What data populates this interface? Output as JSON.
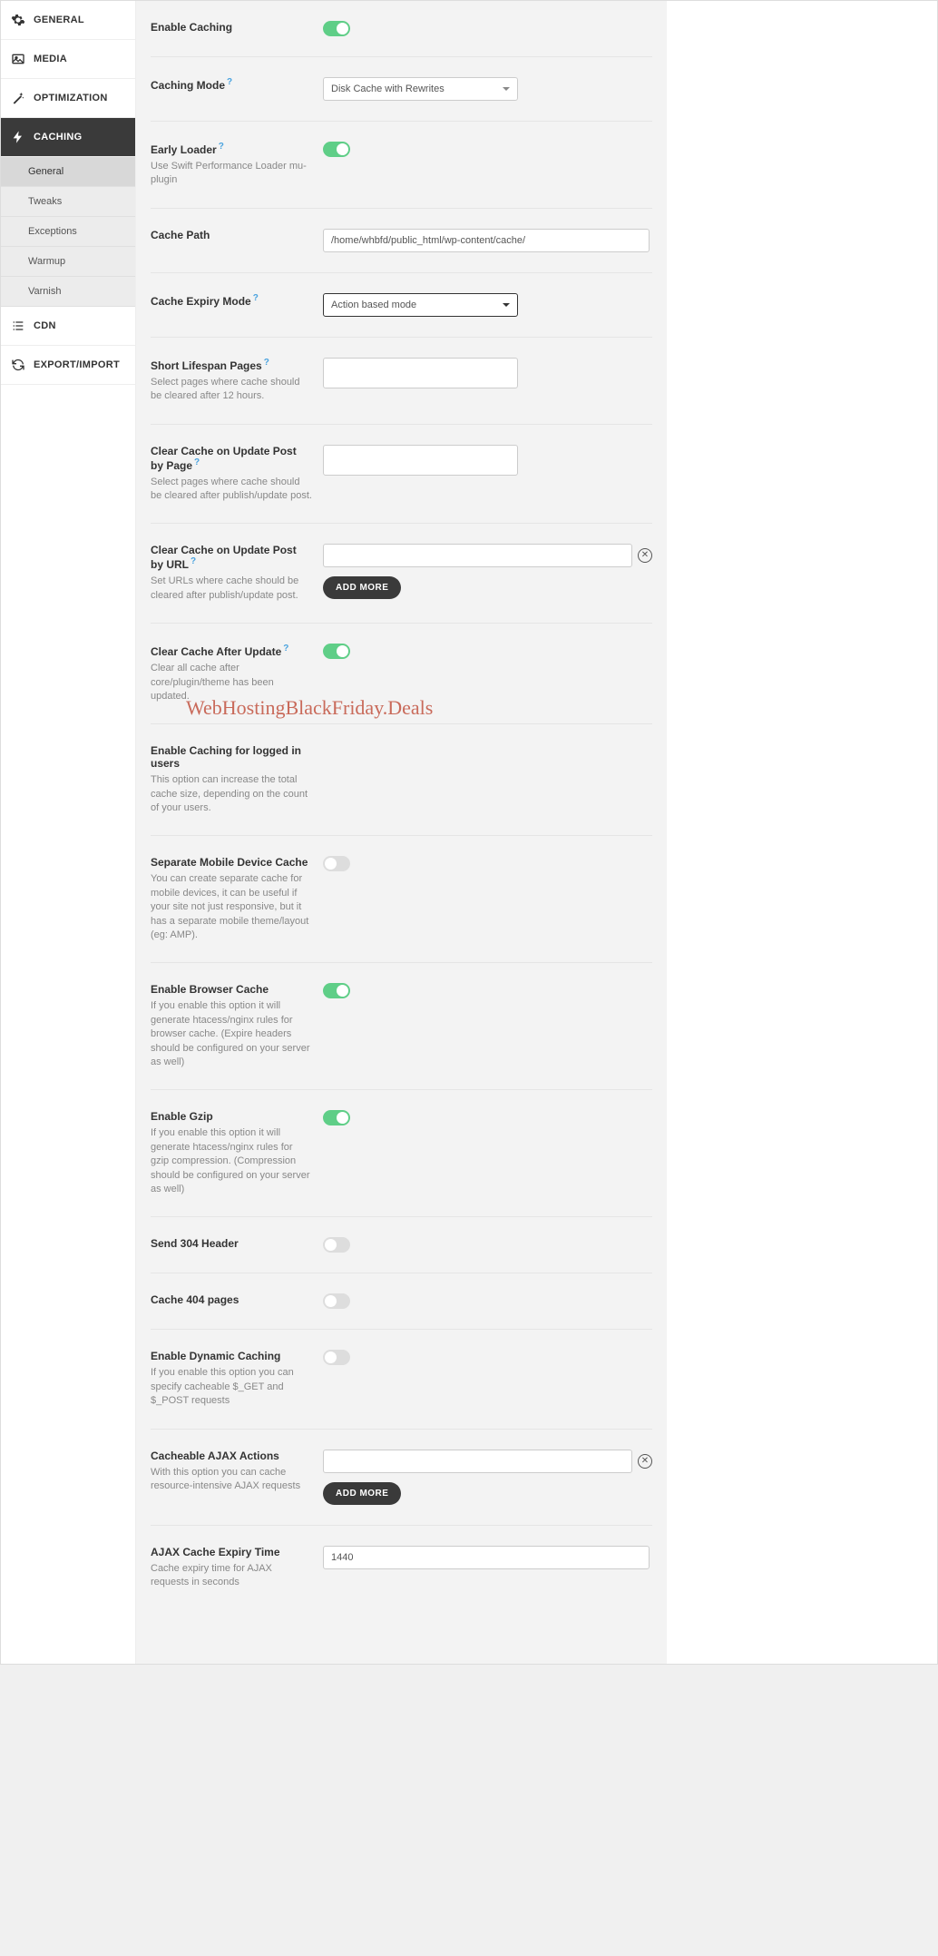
{
  "sidebar": {
    "items": [
      {
        "label": "GENERAL"
      },
      {
        "label": "MEDIA"
      },
      {
        "label": "OPTIMIZATION"
      },
      {
        "label": "CACHING"
      },
      {
        "label": "CDN"
      },
      {
        "label": "EXPORT/IMPORT"
      }
    ],
    "sub": [
      {
        "label": "General"
      },
      {
        "label": "Tweaks"
      },
      {
        "label": "Exceptions"
      },
      {
        "label": "Warmup"
      },
      {
        "label": "Varnish"
      }
    ]
  },
  "rows": {
    "enable_caching": {
      "title": "Enable Caching"
    },
    "caching_mode": {
      "title": "Caching Mode",
      "value": "Disk Cache with Rewrites"
    },
    "early_loader": {
      "title": "Early Loader",
      "desc": "Use Swift Performance Loader mu-plugin"
    },
    "cache_path": {
      "title": "Cache Path",
      "value": "/home/whbfd/public_html/wp-content/cache/"
    },
    "expiry_mode": {
      "title": "Cache Expiry Mode",
      "value": "Action based mode"
    },
    "short_lifespan": {
      "title": "Short Lifespan Pages",
      "desc": "Select pages where cache should be cleared after 12 hours."
    },
    "update_by_page": {
      "title": "Clear Cache on Update Post by Page",
      "desc": "Select pages where cache should be cleared after publish/update post."
    },
    "update_by_url": {
      "title": "Clear Cache on Update Post by URL",
      "desc": "Set URLs where cache should be cleared after publish/update post."
    },
    "after_update": {
      "title": "Clear Cache After Update",
      "desc": "Clear all cache after core/plugin/theme has been updated."
    },
    "logged_in": {
      "title": "Enable Caching for logged in users",
      "desc": "This option can increase the total cache size, depending on the count of your users."
    },
    "mobile": {
      "title": "Separate Mobile Device Cache",
      "desc": "You can create separate cache for mobile devices, it can be useful if your site not just responsive, but it has a separate mobile theme/layout (eg: AMP)."
    },
    "browser_cache": {
      "title": "Enable Browser Cache",
      "desc": "If you enable this option it will generate htacess/nginx rules for browser cache. (Expire headers should be configured on your server as well)"
    },
    "gzip": {
      "title": "Enable Gzip",
      "desc": "If you enable this option it will generate htacess/nginx rules for gzip compression. (Compression should be configured on your server as well)"
    },
    "send_304": {
      "title": "Send 304 Header"
    },
    "cache_404": {
      "title": "Cache 404 pages"
    },
    "dynamic": {
      "title": "Enable Dynamic Caching",
      "desc": "If you enable this option you can specify cacheable $_GET and $_POST requests"
    },
    "ajax_actions": {
      "title": "Cacheable AJAX Actions",
      "desc": "With this option you can cache resource-intensive AJAX requests"
    },
    "ajax_expiry": {
      "title": "AJAX Cache Expiry Time",
      "desc": "Cache expiry time for AJAX requests in seconds",
      "value": "1440"
    }
  },
  "buttons": {
    "add_more": "ADD MORE"
  },
  "watermark": "WebHostingBlackFriday.Deals"
}
